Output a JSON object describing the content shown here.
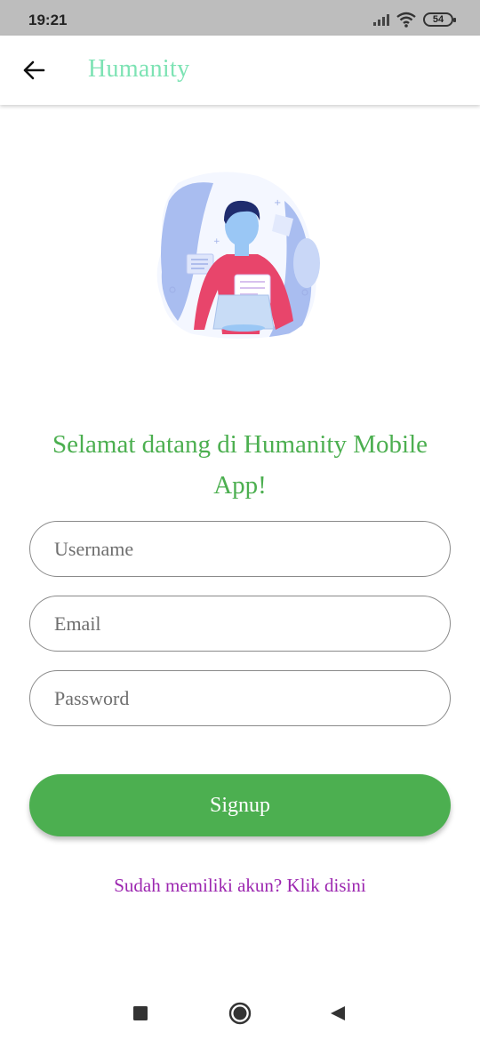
{
  "status_bar": {
    "time": "19:21",
    "battery": "54",
    "icons": [
      "signal-icon",
      "wifi-icon",
      "battery-icon"
    ]
  },
  "app_bar": {
    "title": "Humanity",
    "back_icon": "arrow-left-icon",
    "title_color": "#7de3b4"
  },
  "illustration": {
    "icon": "person-with-laptop-illustration"
  },
  "main": {
    "welcome_text": "Selamat datang di Humanity Mobile App!",
    "welcome_color": "#4caf50",
    "fields": {
      "username_placeholder": "Username",
      "email_placeholder": "Email",
      "password_placeholder": "Password"
    },
    "signup_label": "Signup",
    "signup_color": "#4caf50",
    "login_link": "Sudah memiliki akun? Klik disini",
    "login_link_color": "#9c27b0"
  },
  "nav_bar": {
    "buttons": [
      "recent-apps-icon",
      "home-icon",
      "back-triangle-icon"
    ]
  }
}
